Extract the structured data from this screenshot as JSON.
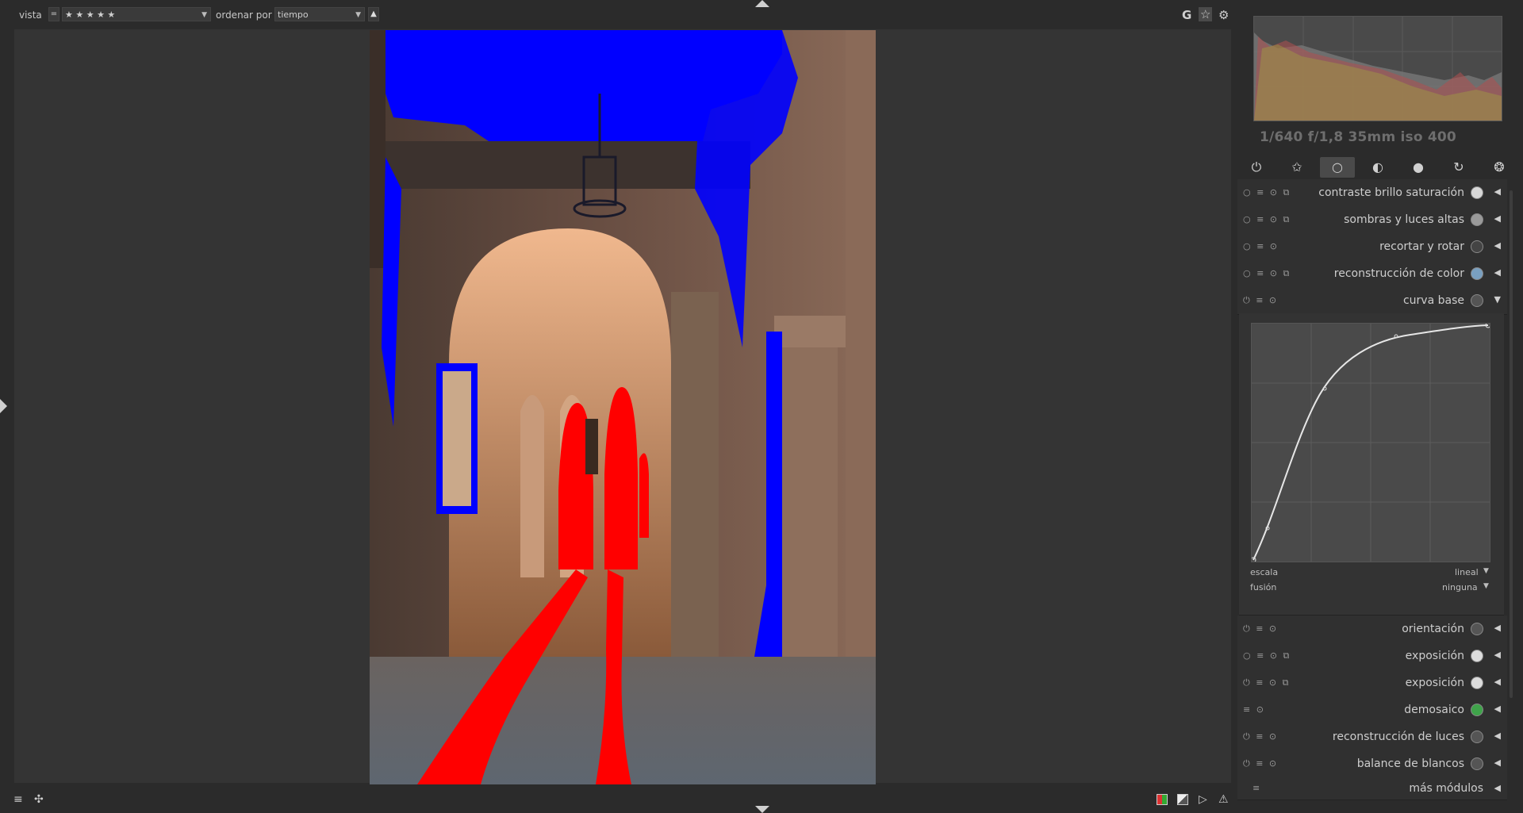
{
  "topbar": {
    "view_label": "vista",
    "view_operator": "=",
    "rating_filter": "★ ★ ★ ★ ★",
    "sort_label": "ordenar por",
    "sort_value": "tiempo",
    "sort_direction_icon": "▲",
    "grouping_icon": "G",
    "star_icon": "☆",
    "prefs_icon": "⚙"
  },
  "histogram": {
    "exif": "1/640 f/1,8 35mm iso 400"
  },
  "module_groups": [
    {
      "icon": "power-icon",
      "glyph": "⏻",
      "active": false
    },
    {
      "icon": "favorites-icon",
      "glyph": "✩",
      "active": false
    },
    {
      "icon": "base-icon",
      "glyph": "○",
      "active": true
    },
    {
      "icon": "tone-icon",
      "glyph": "◐",
      "active": false
    },
    {
      "icon": "color-icon",
      "glyph": "●",
      "active": false
    },
    {
      "icon": "correct-icon",
      "glyph": "↻",
      "active": false
    },
    {
      "icon": "effects-icon",
      "glyph": "❂",
      "active": false
    }
  ],
  "modules_top": [
    {
      "name": "contraste brillo saturación",
      "icon_color": "#d8d8d8",
      "icons": "○ ≡ ⊙ ⧉"
    },
    {
      "name": "sombras y luces altas",
      "icon_color": "#9a9a9a",
      "icons": "○ ≡ ⊙ ⧉"
    },
    {
      "name": "recortar y rotar",
      "icon_color": "#444444",
      "icons": "○ ≡ ⊙"
    },
    {
      "name": "reconstrucción de color",
      "icon_color": "#7aa0c0",
      "icons": "○ ≡ ⊙ ⧉"
    },
    {
      "name": "curva base",
      "icon_color": "#555555",
      "icons": "⏻ ≡ ⊙"
    }
  ],
  "curve": {
    "scale_label": "escala",
    "scale_value": "lineal",
    "blend_label": "fusión",
    "blend_value": "ninguna"
  },
  "modules_bottom": [
    {
      "name": "orientación",
      "icon_color": "#555555",
      "icons": "⏻ ≡ ⊙"
    },
    {
      "name": "exposición",
      "icon_color": "#dddddd",
      "icons": "○ ≡ ⊙ ⧉"
    },
    {
      "name": "exposición",
      "icon_color": "#dddddd",
      "icons": "⏻ ≡ ⊙ ⧉"
    },
    {
      "name": "demosaico",
      "icon_color": "#3fa34a",
      "icons": "≡ ⊙"
    },
    {
      "name": "reconstrucción de luces",
      "icon_color": "#555555",
      "icons": "⏻ ≡ ⊙"
    },
    {
      "name": "balance de blancos",
      "icon_color": "#555555",
      "icons": "⏻ ≡ ⊙"
    }
  ],
  "more_modules": "más módulos",
  "bottombar": {
    "menu_icon": "≡",
    "styles_icon": "✣"
  },
  "expand_arrow": "◀",
  "collapse_arrow": "▼"
}
